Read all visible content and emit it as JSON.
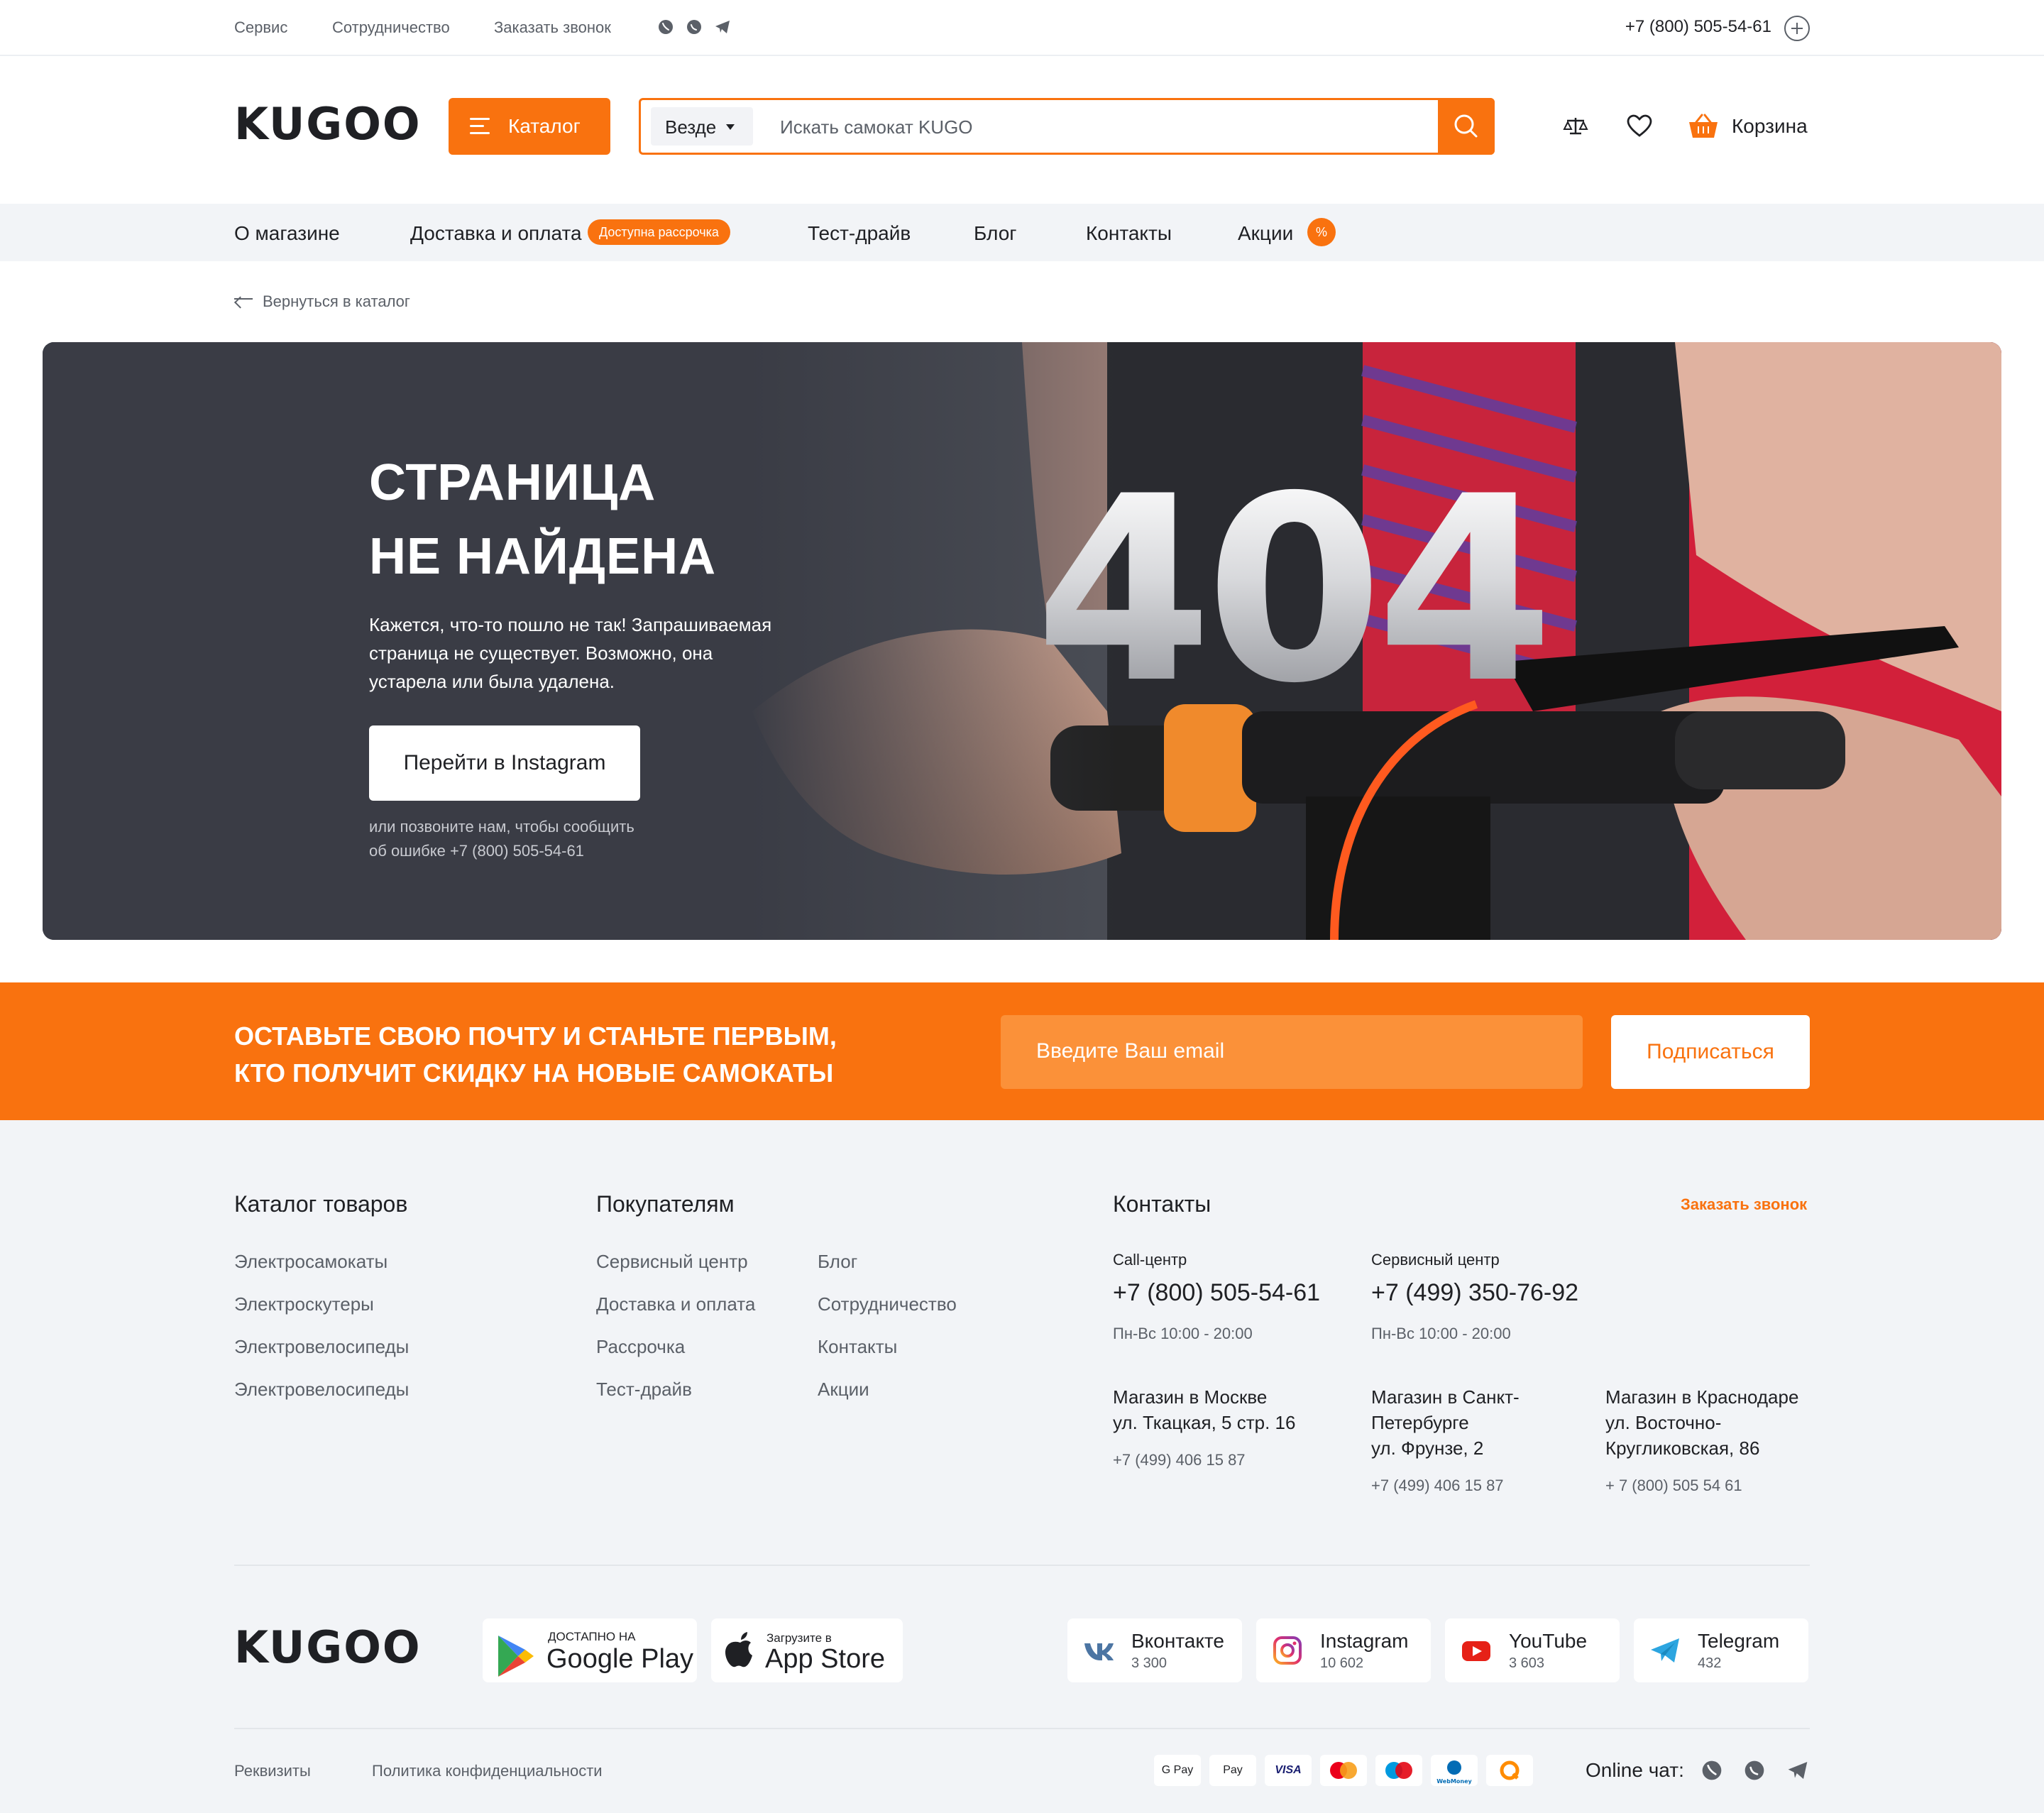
{
  "topbar": {
    "links": [
      "Сервис",
      "Сотрудничество",
      "Заказать звонок"
    ],
    "social_icons": [
      "viber-icon",
      "whatsapp-icon",
      "telegram-icon"
    ],
    "phone": "+7 (800) 505-54-61"
  },
  "header": {
    "logo": "KUGOO",
    "catalog_label": "Каталог",
    "search_scope": "Везде",
    "search_placeholder": "Искать самокат KUGO",
    "cart_label": "Корзина"
  },
  "nav": {
    "items": [
      "О магазине",
      "Доставка и оплата",
      "Тест-драйв",
      "Блог",
      "Контакты",
      "Акции"
    ],
    "installment_badge": "Доступна рассрочка",
    "sale_badge": "%"
  },
  "back_link": "Вернуться в каталог",
  "hero": {
    "title_line1": "СТРАНИЦА",
    "title_line2": "НЕ НАЙДЕНА",
    "big_code": "404",
    "description": "Кажется, что-то пошло не так! Запрашиваемая страница не существует. Возможно, она устарела или была удалена.",
    "button_label": "Перейти в Instagram",
    "note_line1": "или позвоните нам, чтобы сообщить",
    "note_line2": "об ошибке +7 (800) 505-54-61"
  },
  "subscribe": {
    "line1": "ОСТАВЬТЕ СВОЮ ПОЧТУ И СТАНЬТЕ ПЕРВЫМ,",
    "line2": "КТО ПОЛУЧИТ СКИДКУ НА НОВЫЕ САМОКАТЫ",
    "placeholder": "Введите Ваш email",
    "button": "Подписаться"
  },
  "footer": {
    "catalog": {
      "title": "Каталог товаров",
      "links": [
        "Электросамокаты",
        "Электроскутеры",
        "Электровелосипеды",
        "Электровелосипеды"
      ]
    },
    "buyers": {
      "title": "Покупателям",
      "col1": [
        "Сервисный центр",
        "Доставка и оплата",
        "Рассрочка",
        "Тест-драйв"
      ],
      "col2": [
        "Блог",
        "Сотрудничество",
        "Контакты",
        "Акции"
      ]
    },
    "contacts": {
      "title": "Контакты",
      "order_call": "Заказать звонок",
      "call_center": {
        "label": "Call-центр",
        "phone": "+7 (800) 505-54-61",
        "hours": "Пн-Вс 10:00 - 20:00"
      },
      "service_center": {
        "label": "Сервисный центр",
        "phone": "+7 (499) 350-76-92",
        "hours": "Пн-Вс 10:00 - 20:00"
      },
      "stores": [
        {
          "lines": [
            "Магазин в Москве",
            "ул. Ткацкая, 5 стр. 16"
          ],
          "phone": "+7 (499) 406 15 87"
        },
        {
          "lines": [
            "Магазин в Санкт-",
            "Петербурге",
            "ул. Фрунзе, 2"
          ],
          "phone": "+7 (499) 406 15 87"
        },
        {
          "lines": [
            "Магазин в Краснодаре",
            "ул. Восточно-",
            "Кругликовская, 86"
          ],
          "phone": "+ 7 (800) 505 54 61"
        }
      ]
    },
    "logo": "KUGOO",
    "apps": [
      {
        "small": "ДОСТАПНО НА",
        "big": "Google Play",
        "icon": "google-play-icon"
      },
      {
        "small": "Загрузите в",
        "big": "App Store",
        "icon": "apple-icon"
      }
    ],
    "socials": [
      {
        "name": "Вконтакте",
        "count": "3 300",
        "icon": "vk-icon",
        "color": "#4c75a3"
      },
      {
        "name": "Instagram",
        "count": "10 602",
        "icon": "instagram-icon",
        "color": "#e1306c"
      },
      {
        "name": "YouTube",
        "count": "3 603",
        "icon": "youtube-icon",
        "color": "#e62117"
      },
      {
        "name": "Telegram",
        "count": "432",
        "icon": "telegram-icon",
        "color": "#2ca5e0"
      }
    ],
    "bottom_links": [
      "Реквизиты",
      "Политика конфиденциальности"
    ],
    "payments": [
      "G Pay",
      "Pay",
      "VISA",
      "mastercard",
      "maestro",
      "WebMoney",
      "qiwi"
    ],
    "online_chat": "Online чат:"
  },
  "colors": {
    "accent": "#f9720f",
    "dark": "#1f2024",
    "muted": "#5b6068",
    "light_bg": "#f2f4f7"
  }
}
